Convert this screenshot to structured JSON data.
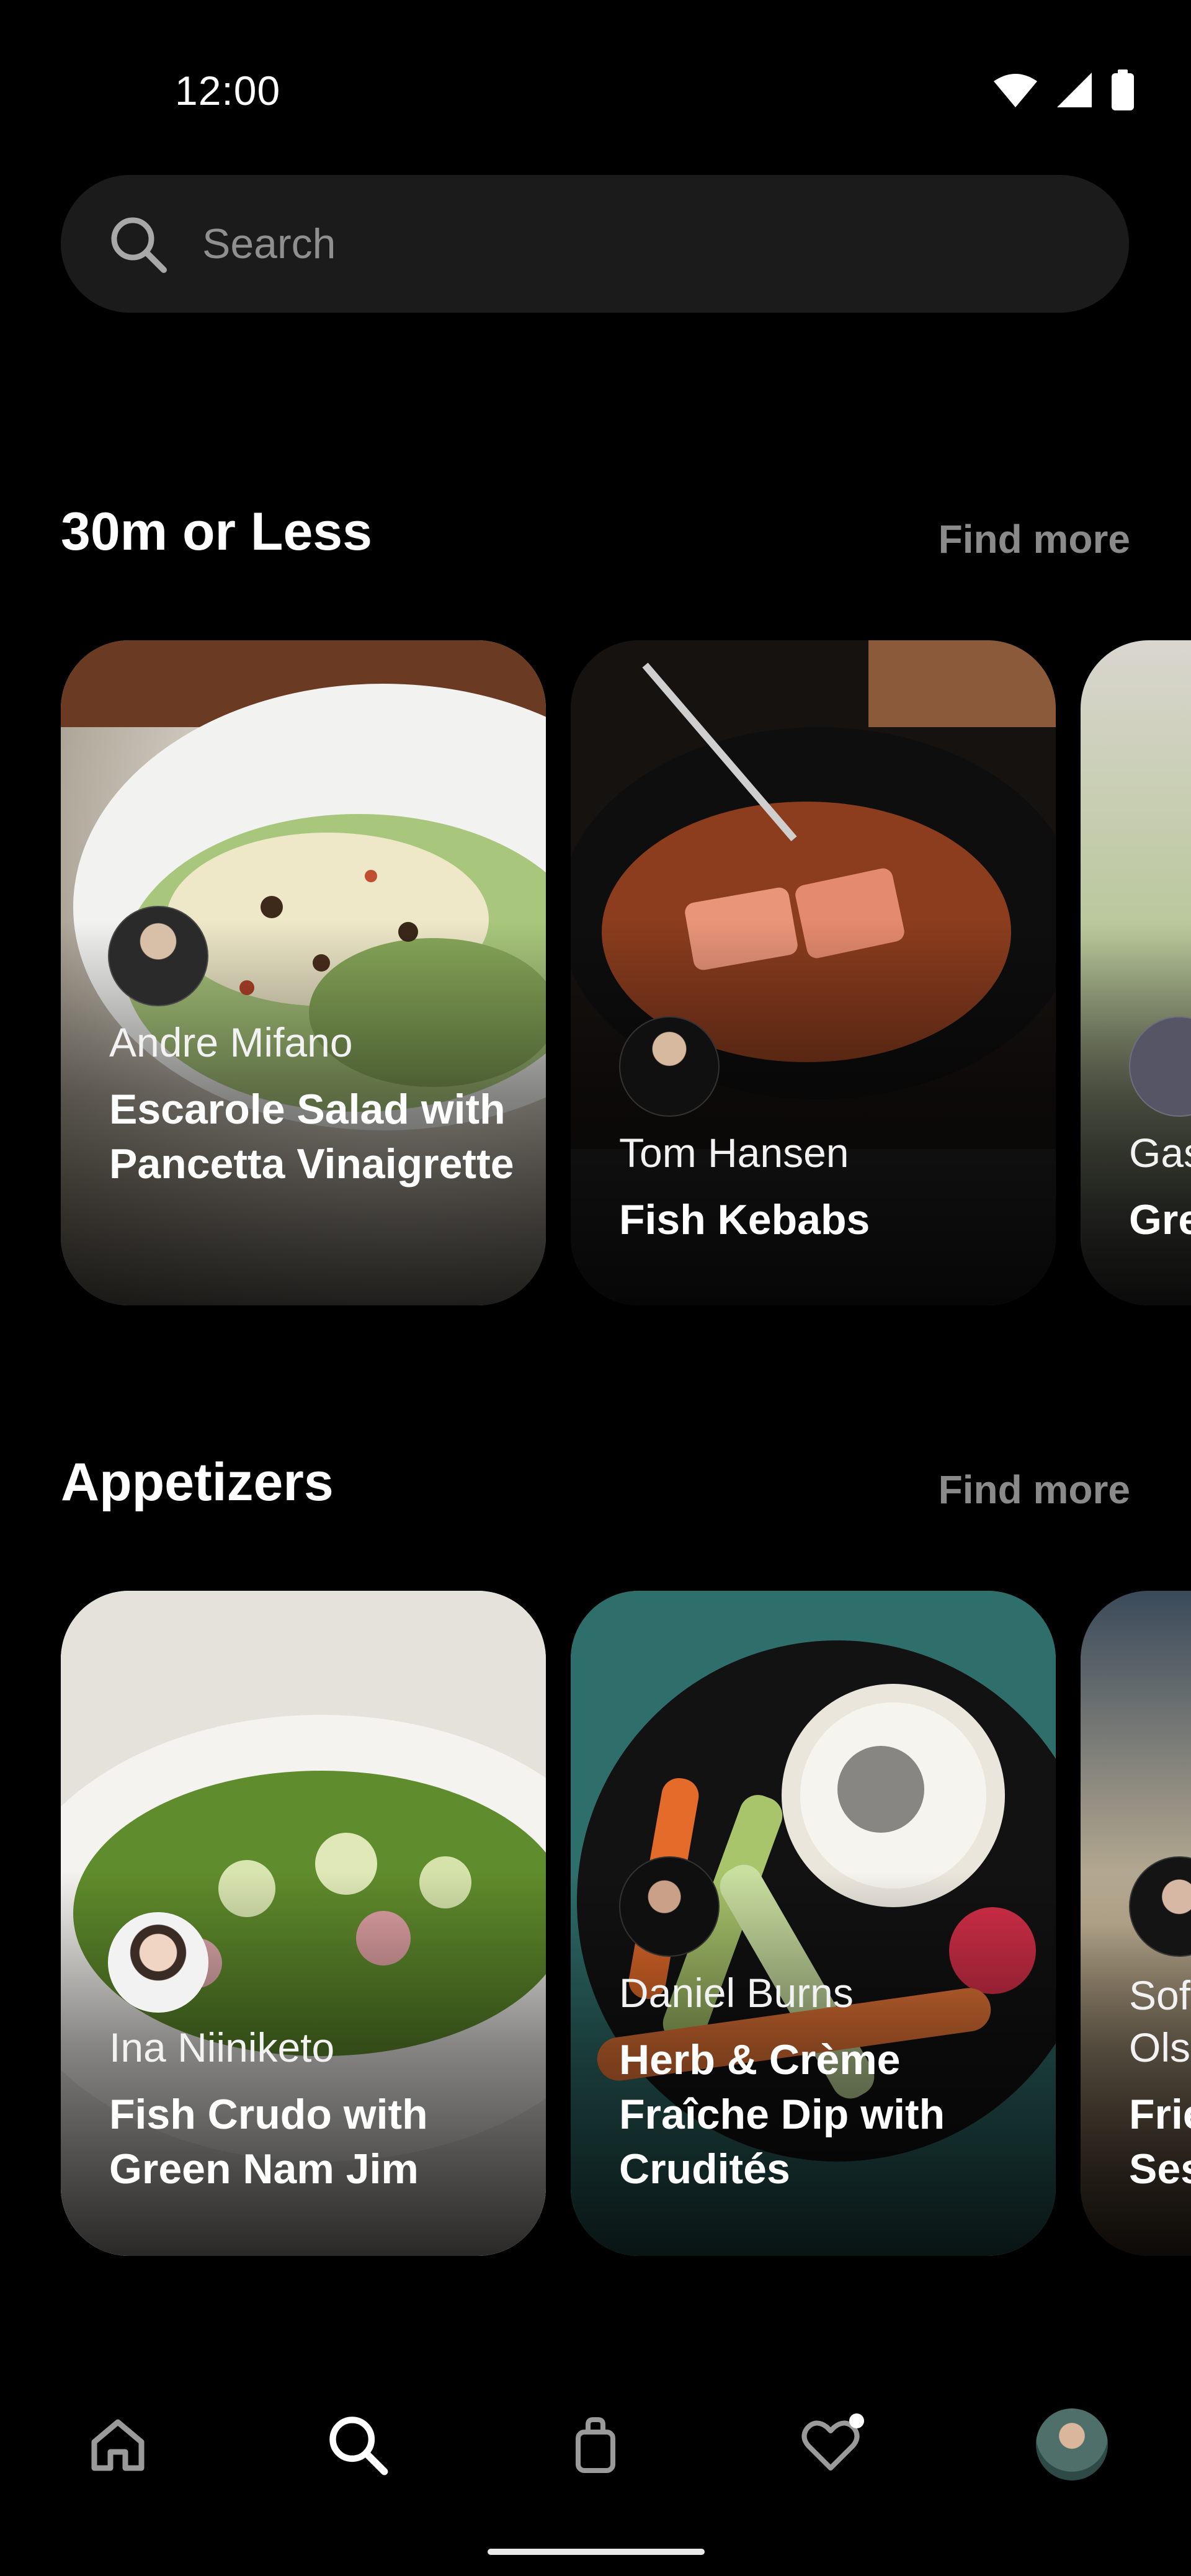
{
  "status_bar": {
    "time": "12:00"
  },
  "search": {
    "placeholder": "Search",
    "value": ""
  },
  "sections": [
    {
      "title": "30m or Less",
      "find_more": "Find more",
      "cards": [
        {
          "chef": "Andre Mifano",
          "dish": "Escarole Salad with Pancetta Vinaigrette"
        },
        {
          "chef": "Tom Hansen",
          "dish": "Fish Kebabs"
        },
        {
          "chef": "Gas",
          "dish": "Gre"
        }
      ]
    },
    {
      "title": "Appetizers",
      "find_more": "Find more",
      "cards": [
        {
          "chef": "Ina Niiniketo",
          "dish": "Fish Crudo with Green Nam Jim"
        },
        {
          "chef": "Daniel Burns",
          "dish": "Herb & Crème Fraîche Dip with Crudités"
        },
        {
          "chef": "Sof Ols",
          "dish": "Frie Ses"
        }
      ]
    }
  ],
  "bottom_nav": {
    "items": [
      "home-icon",
      "search-icon",
      "shopping-bag-icon",
      "favorites-icon",
      "profile-avatar"
    ],
    "active": "search-icon"
  },
  "colors": {
    "background": "#000000",
    "search_bg": "#1b1b1b",
    "muted_text": "#8a8a8a"
  }
}
